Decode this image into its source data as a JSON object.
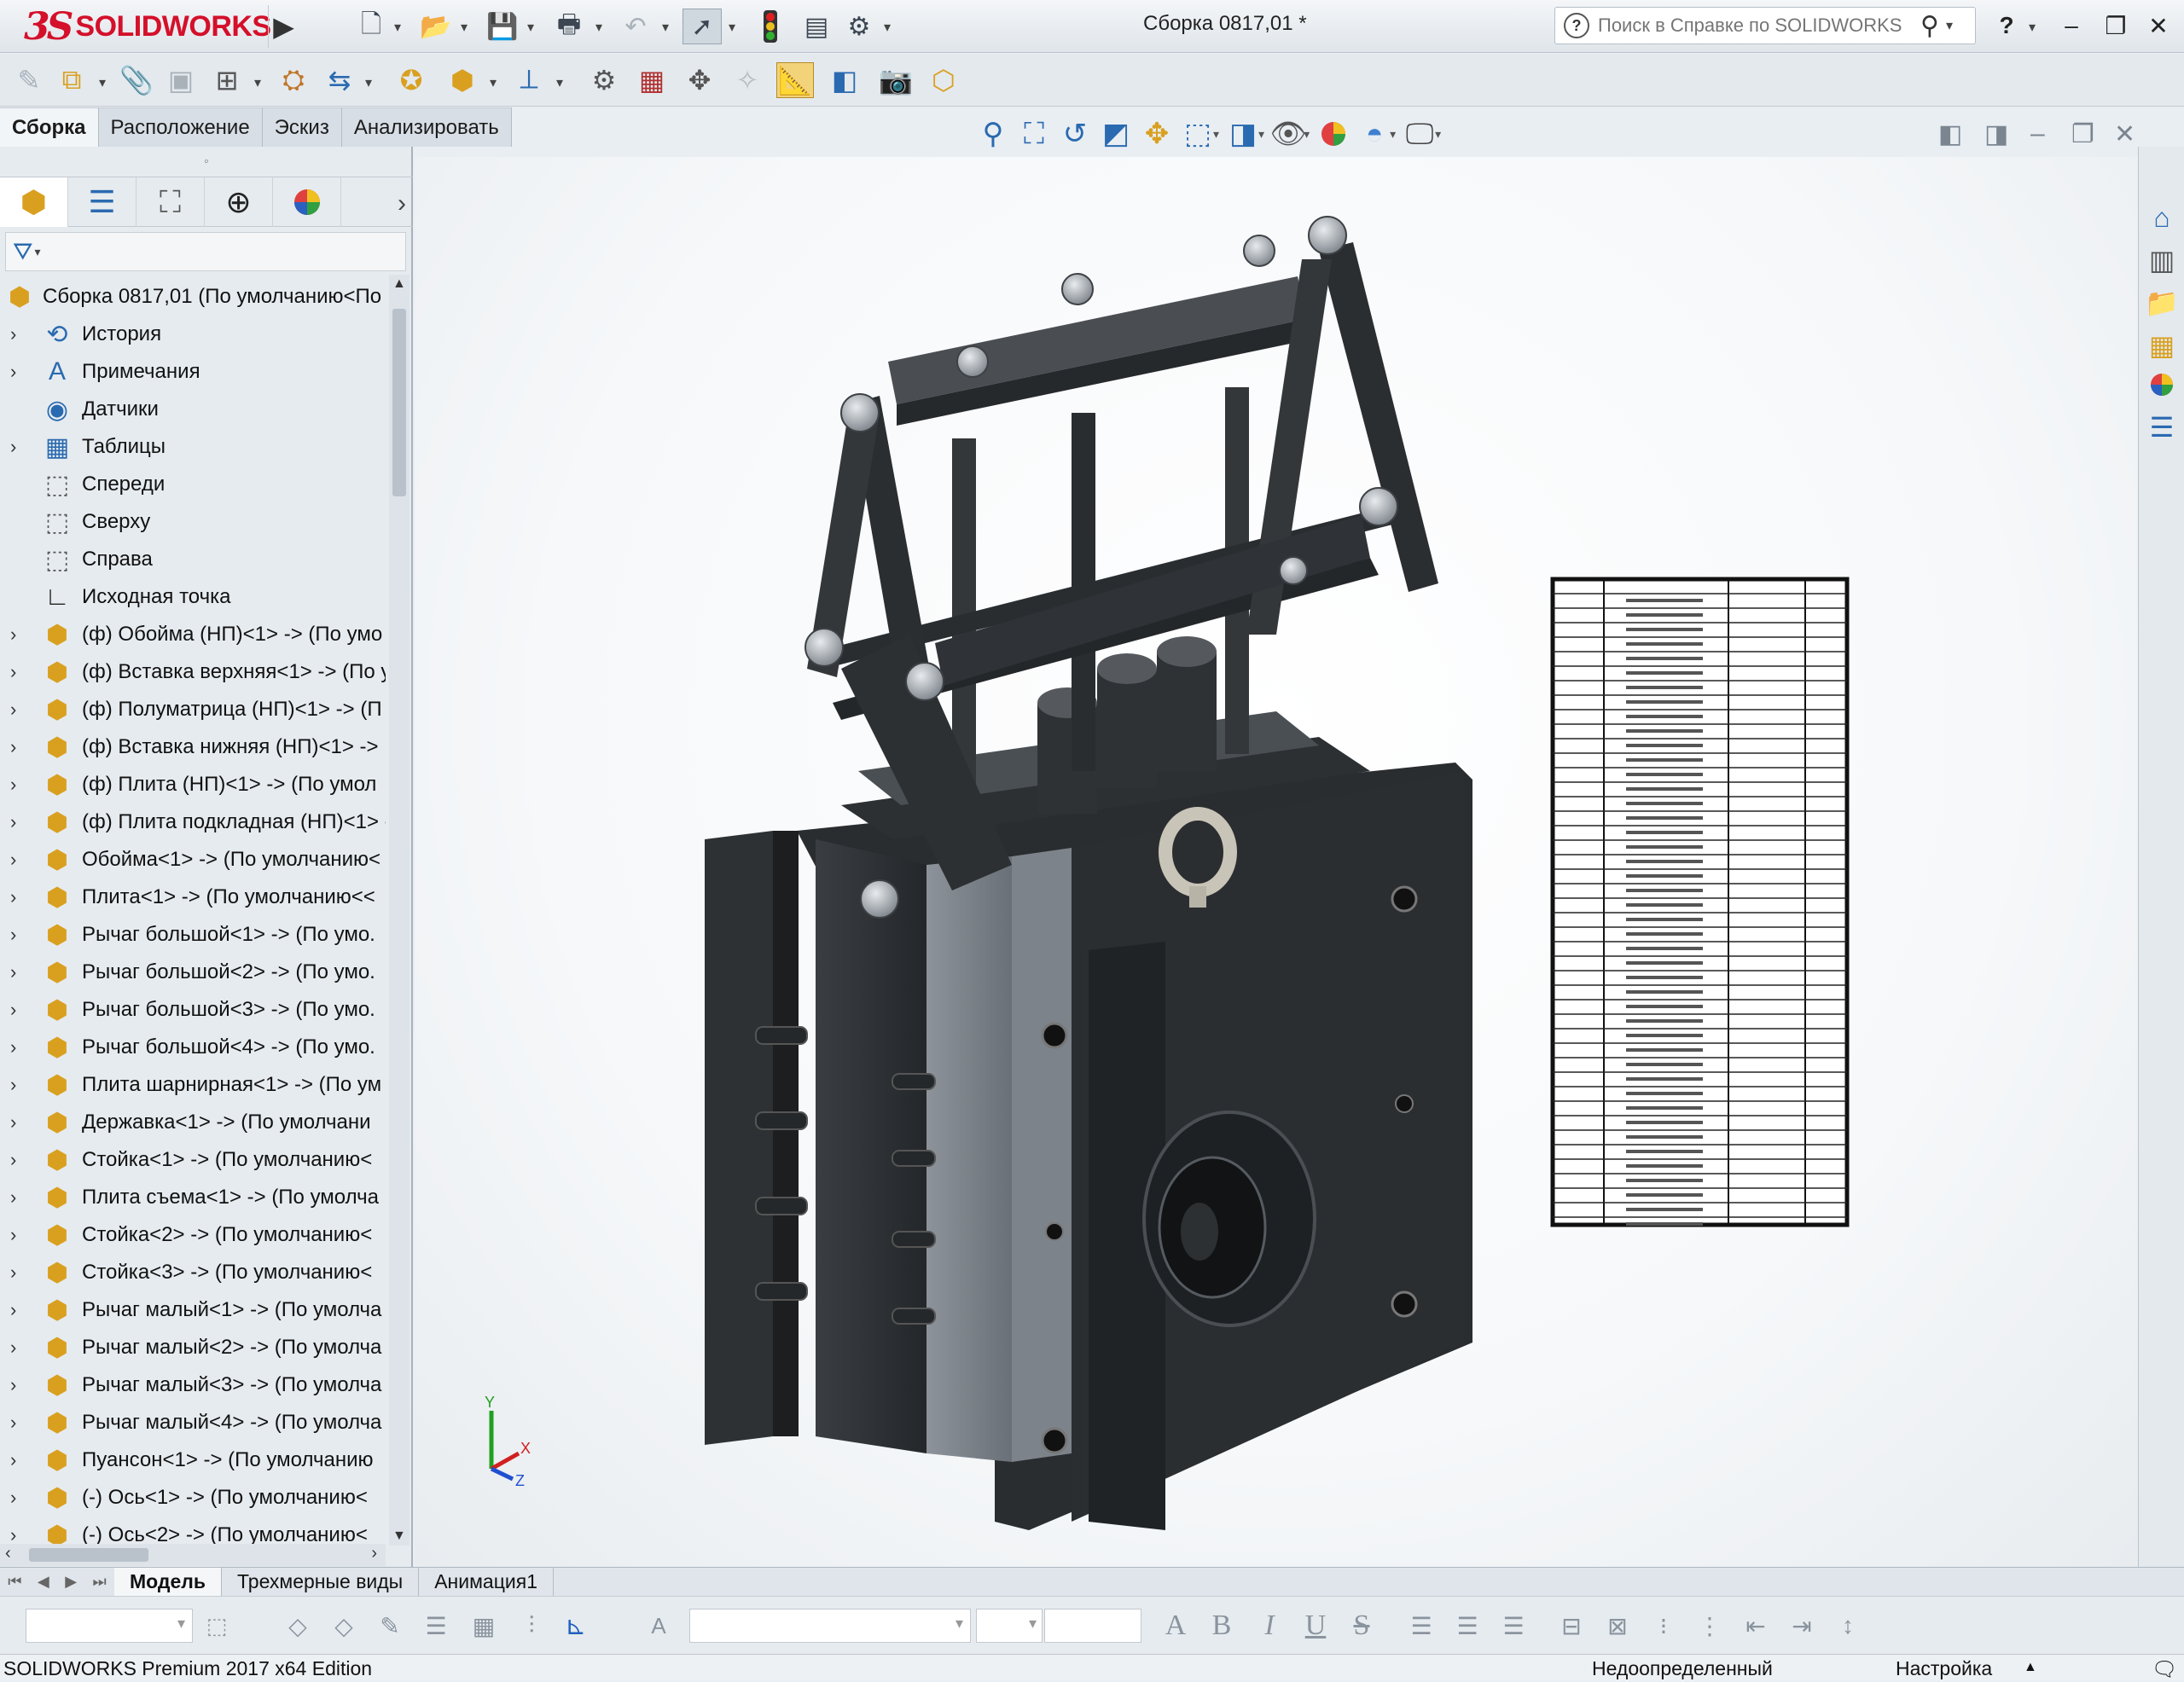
{
  "app": {
    "brand_ds": "3S",
    "brand_name": "SOLIDWORKS",
    "document_title": "Сборка 0817,01 *",
    "help_search_placeholder": "Поиск в Справке по SOLIDWORKS",
    "accent_color": "#d4102a",
    "selection_highlight": "#f3d37a"
  },
  "ribbon_tabs": [
    "Сборка",
    "Расположение",
    "Эскиз",
    "Анализировать"
  ],
  "feature_tree": {
    "root": "Сборка 0817,01  (По умолчанию<По",
    "items": [
      {
        "label": "История",
        "icon": "history-icon",
        "expandable": true
      },
      {
        "label": "Примечания",
        "icon": "annotations-icon",
        "expandable": true
      },
      {
        "label": "Датчики",
        "icon": "sensors-icon",
        "expandable": false
      },
      {
        "label": "Таблицы",
        "icon": "tables-icon",
        "expandable": true
      },
      {
        "label": "Спереди",
        "icon": "plane-icon",
        "expandable": false
      },
      {
        "label": "Сверху",
        "icon": "plane-icon",
        "expandable": false
      },
      {
        "label": "Справа",
        "icon": "plane-icon",
        "expandable": false
      },
      {
        "label": "Исходная точка",
        "icon": "origin-icon",
        "expandable": false
      },
      {
        "label": "(ф) Обойма (НП)<1> -> (По умо",
        "icon": "part-icon",
        "expandable": true
      },
      {
        "label": "(ф) Вставка верхняя<1> -> (По у",
        "icon": "part-icon",
        "expandable": true
      },
      {
        "label": "(ф) Полуматрица (НП)<1> -> (П",
        "icon": "part-icon",
        "expandable": true
      },
      {
        "label": "(ф) Вставка нижняя (НП)<1> ->",
        "icon": "part-icon",
        "expandable": true
      },
      {
        "label": "(ф) Плита (НП)<1> -> (По умол",
        "icon": "part-icon",
        "expandable": true
      },
      {
        "label": "(ф) Плита подкладная (НП)<1> -",
        "icon": "part-icon",
        "expandable": true
      },
      {
        "label": "Обойма<1> -> (По умолчанию<",
        "icon": "part-icon",
        "expandable": true
      },
      {
        "label": "Плита<1> -> (По умолчанию<<",
        "icon": "part-icon",
        "expandable": true
      },
      {
        "label": "Рычаг большой<1> -> (По умо.",
        "icon": "part-icon",
        "expandable": true
      },
      {
        "label": "Рычаг большой<2> -> (По умо.",
        "icon": "part-icon",
        "expandable": true
      },
      {
        "label": "Рычаг большой<3> -> (По умо.",
        "icon": "part-icon",
        "expandable": true
      },
      {
        "label": "Рычаг большой<4> -> (По умо.",
        "icon": "part-icon",
        "expandable": true
      },
      {
        "label": "Плита шарнирная<1> -> (По ум",
        "icon": "part-icon",
        "expandable": true
      },
      {
        "label": "Державка<1> -> (По умолчани",
        "icon": "part-icon",
        "expandable": true
      },
      {
        "label": "Стойка<1> -> (По умолчанию<",
        "icon": "part-icon",
        "expandable": true
      },
      {
        "label": "Плита съема<1> -> (По умолча",
        "icon": "part-icon",
        "expandable": true
      },
      {
        "label": "Стойка<2> -> (По умолчанию<",
        "icon": "part-icon",
        "expandable": true
      },
      {
        "label": "Стойка<3> -> (По умолчанию<",
        "icon": "part-icon",
        "expandable": true
      },
      {
        "label": "Рычаг малый<1> -> (По умолча",
        "icon": "part-icon",
        "expandable": true
      },
      {
        "label": "Рычаг малый<2> -> (По умолча",
        "icon": "part-icon",
        "expandable": true
      },
      {
        "label": "Рычаг малый<3> -> (По умолча",
        "icon": "part-icon",
        "expandable": true
      },
      {
        "label": "Рычаг малый<4> -> (По умолча",
        "icon": "part-icon",
        "expandable": true
      },
      {
        "label": "Пуансон<1> -> (По умолчанию",
        "icon": "part-icon",
        "expandable": true
      },
      {
        "label": "(-) Ось<1> -> (По умолчанию<",
        "icon": "part-icon",
        "expandable": true
      },
      {
        "label": "(-) Ось<2> -> (По умолчанию<",
        "icon": "part-icon",
        "expandable": true
      }
    ]
  },
  "triad": {
    "x": "X",
    "y": "Y",
    "z": "Z"
  },
  "bottom_tabs": [
    "Модель",
    "Трехмерные виды",
    "Анимация1"
  ],
  "format_bar": {
    "bold": "B",
    "italic": "I",
    "underline": "U",
    "strike": "S",
    "text_a": "A"
  },
  "status": {
    "edition": "SOLIDWORKS Premium 2017 x64 Edition",
    "state": "Недоопределенный",
    "custom": "Настройка"
  }
}
